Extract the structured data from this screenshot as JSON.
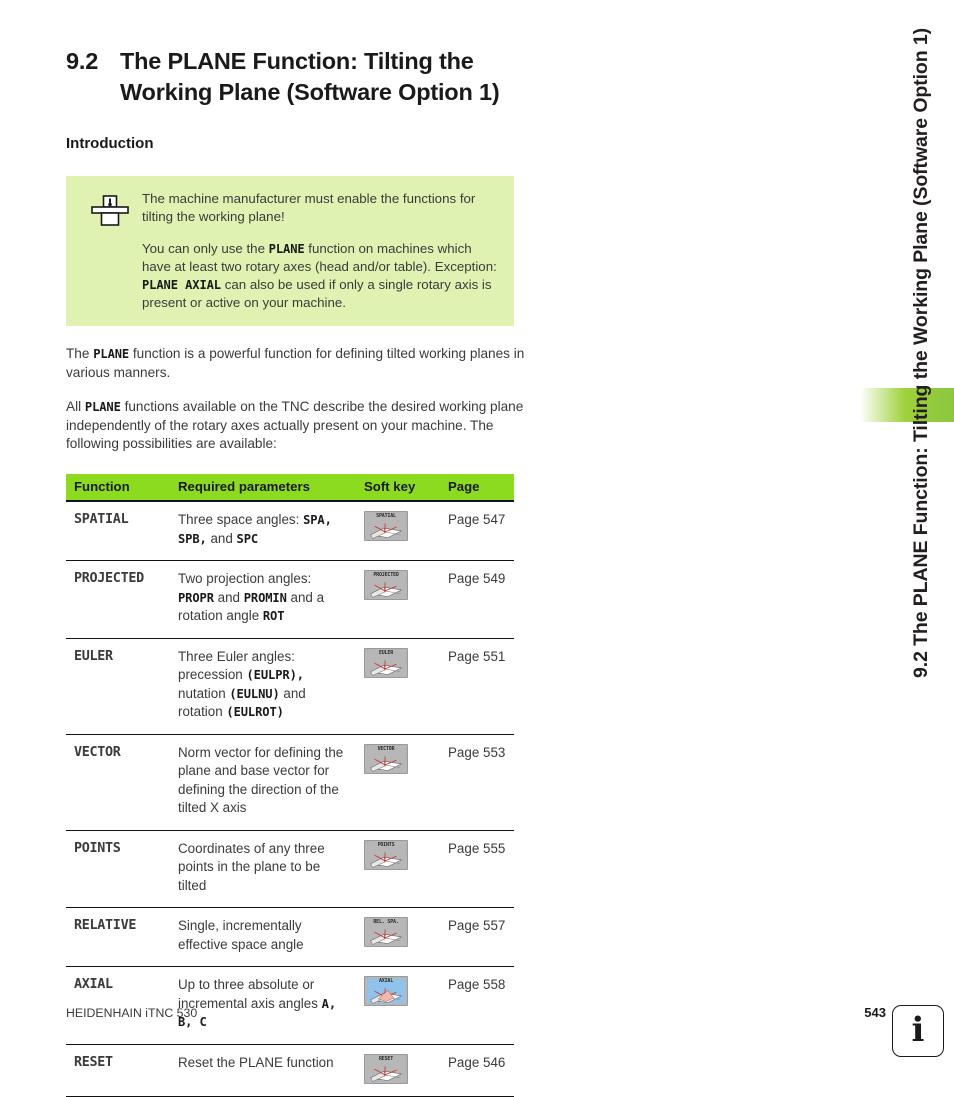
{
  "sidebar": {
    "running_head": "9.2 The PLANE Function: Tilting the Working Plane (Software Option 1)",
    "tab_color": "#8cc63f"
  },
  "heading": {
    "number": "9.2",
    "title": "The PLANE Function: Tilting the Working Plane (Software Option 1)"
  },
  "section": {
    "title": "Introduction"
  },
  "note": {
    "icon": "machine-tool-icon",
    "background": "#dff2b2",
    "paragraph1": "The machine manufacturer must enable the functions for tilting the working plane!",
    "p2_a": "You can only use the ",
    "p2_code1": "PLANE",
    "p2_b": " function on machines which have at least two rotary axes (head and/or table). Exception: ",
    "p2_code2": "PLANE AXIAL",
    "p2_c": " can also be used if only a single rotary axis is present or active on your machine."
  },
  "intro": {
    "p1_a": "The ",
    "p1_code": "PLANE",
    "p1_b": " function is a powerful function for defining tilted working planes in various manners.",
    "p2_a": "All ",
    "p2_code": "PLANE",
    "p2_b": " functions available on the TNC describe the desired working plane independently of the rotary axes actually present on your machine. The following possibilities are available:"
  },
  "table": {
    "header_color": "#8ddb1e",
    "columns": [
      "Function",
      "Required parameters",
      "Soft key",
      "Page"
    ],
    "rows": [
      {
        "function": "SPATIAL",
        "softkey_label": "SPATIAL",
        "softkey_style": "grey",
        "page": "Page 547",
        "params": [
          {
            "t": "Three space angles: ",
            "b": false
          },
          {
            "t": "SPA,",
            "b": true
          },
          {
            "t": " ",
            "b": false
          },
          {
            "t": "SPB,",
            "b": true
          },
          {
            "t": " and ",
            "b": false
          },
          {
            "t": "SPC",
            "b": true
          }
        ]
      },
      {
        "function": "PROJECTED",
        "softkey_label": "PROJECTED",
        "softkey_style": "grey",
        "page": "Page 549",
        "params": [
          {
            "t": "Two projection angles: ",
            "b": false
          },
          {
            "t": "PROPR",
            "b": true
          },
          {
            "t": " and ",
            "b": false
          },
          {
            "t": "PROMIN",
            "b": true
          },
          {
            "t": " and a rotation angle ",
            "b": false
          },
          {
            "t": "ROT",
            "b": true
          }
        ]
      },
      {
        "function": "EULER",
        "softkey_label": "EULER",
        "softkey_style": "grey",
        "page": "Page 551",
        "params": [
          {
            "t": "Three Euler angles: precession ",
            "b": false
          },
          {
            "t": "(EULPR),",
            "b": true
          },
          {
            "t": " nutation ",
            "b": false
          },
          {
            "t": "(EULNU)",
            "b": true
          },
          {
            "t": " and rotation ",
            "b": false
          },
          {
            "t": "(EULROT)",
            "b": true
          }
        ]
      },
      {
        "function": "VECTOR",
        "softkey_label": "VECTOR",
        "softkey_style": "grey",
        "page": "Page 553",
        "params": [
          {
            "t": "Norm vector for defining the plane and base vector for defining the direction of the tilted X axis",
            "b": false
          }
        ]
      },
      {
        "function": "POINTS",
        "softkey_label": "POINTS",
        "softkey_style": "grey",
        "page": "Page 555",
        "params": [
          {
            "t": "Coordinates of any three points in the plane to be tilted",
            "b": false
          }
        ]
      },
      {
        "function": "RELATIVE",
        "softkey_label": "REL. SPA.",
        "softkey_style": "grey",
        "page": "Page 557",
        "params": [
          {
            "t": "Single, incrementally effective space angle",
            "b": false
          }
        ]
      },
      {
        "function": "AXIAL",
        "softkey_label": "AXIAL",
        "softkey_style": "blue",
        "page": "Page 558",
        "params": [
          {
            "t": "Up to three absolute or incremental axis angles ",
            "b": false
          },
          {
            "t": "A, B, C",
            "b": true
          }
        ]
      },
      {
        "function": "RESET",
        "softkey_label": "RESET",
        "softkey_style": "grey",
        "page": "Page 546",
        "params": [
          {
            "t": "Reset the PLANE function",
            "b": false
          }
        ]
      }
    ]
  },
  "footer": {
    "left": "HEIDENHAIN iTNC 530",
    "page_number": "543",
    "info_glyph": "i"
  }
}
